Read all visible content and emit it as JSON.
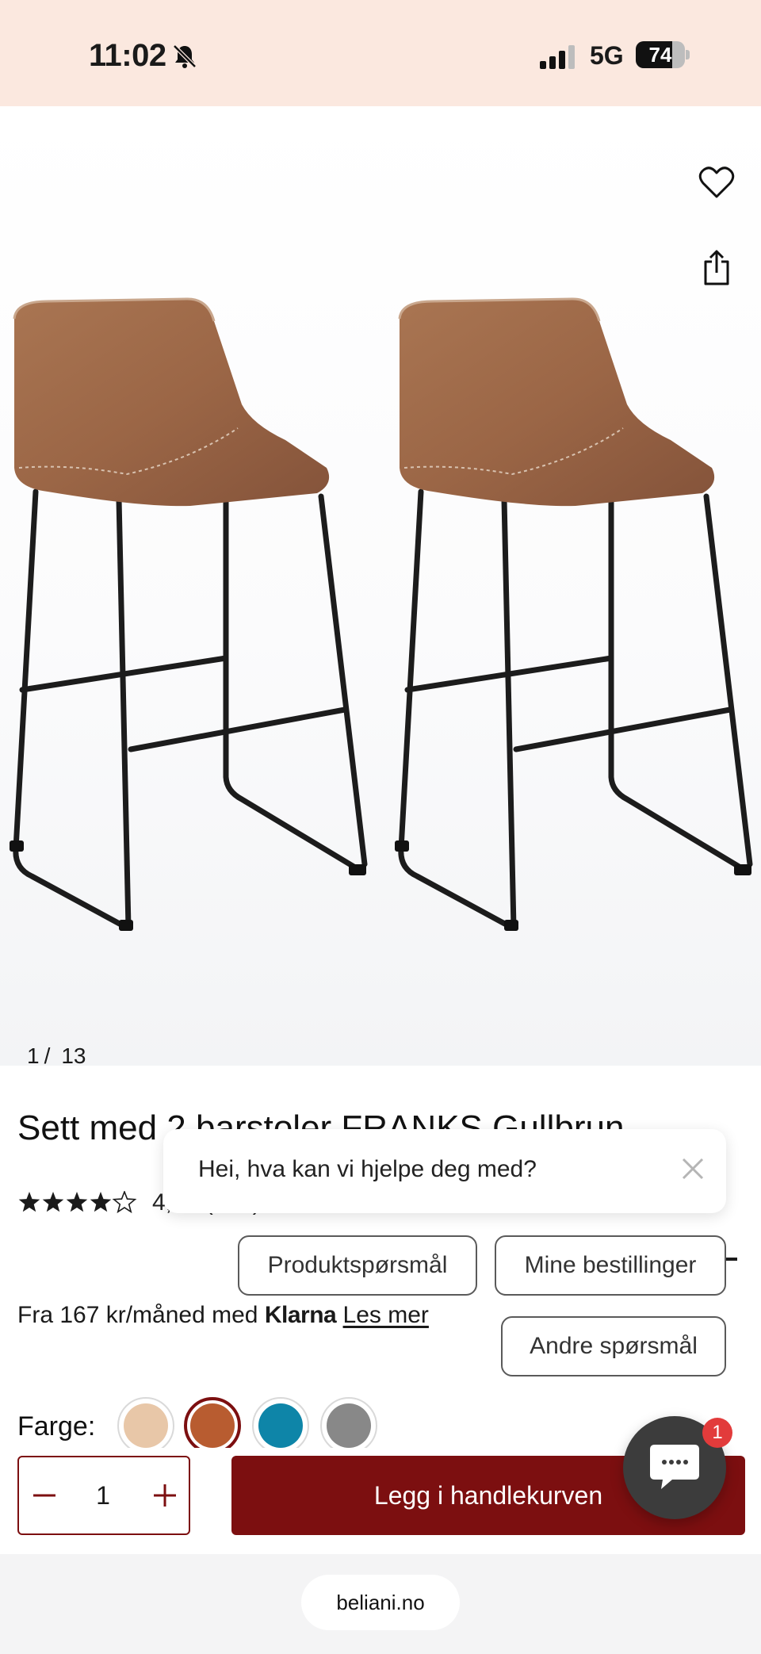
{
  "status_bar": {
    "time": "11:02",
    "network": "5G",
    "battery": "74",
    "battery_level": 0.74,
    "icons": [
      "bell-slash-icon",
      "cellular-signal-icon",
      "battery-icon"
    ]
  },
  "gallery": {
    "current": "1",
    "separator": "/",
    "total": "13",
    "icons": [
      "heart-icon",
      "share-icon"
    ]
  },
  "product": {
    "title": "Sett med 2 barstoler FRANKS Gullbrun",
    "rating_text": "4,45 (242)",
    "rating_value": 4.45,
    "rating_max": 5,
    "klarna_prefix": "Fra 167 kr/måned med",
    "klarna_brand": "Klarna",
    "klarna_link": "Les mer",
    "colors_label": "Farge:",
    "colors": [
      "#e8c7a8",
      "#b85c30",
      "#0e85a8",
      "#888888"
    ],
    "selected_color": 1
  },
  "chat": {
    "greeting": "Hei, hva kan vi hjelpe deg med?",
    "buttons": [
      "Produktspørsmål",
      "Mine bestillinger",
      "Andre spørsmål"
    ],
    "badge": "1"
  },
  "cart": {
    "quantity": "1",
    "button_label": "Legg i handlekurven"
  },
  "browser": {
    "url": "beliani.no"
  },
  "theme": {
    "accent": "#7c0f10",
    "status_bar_bg": "#fbe8df"
  }
}
